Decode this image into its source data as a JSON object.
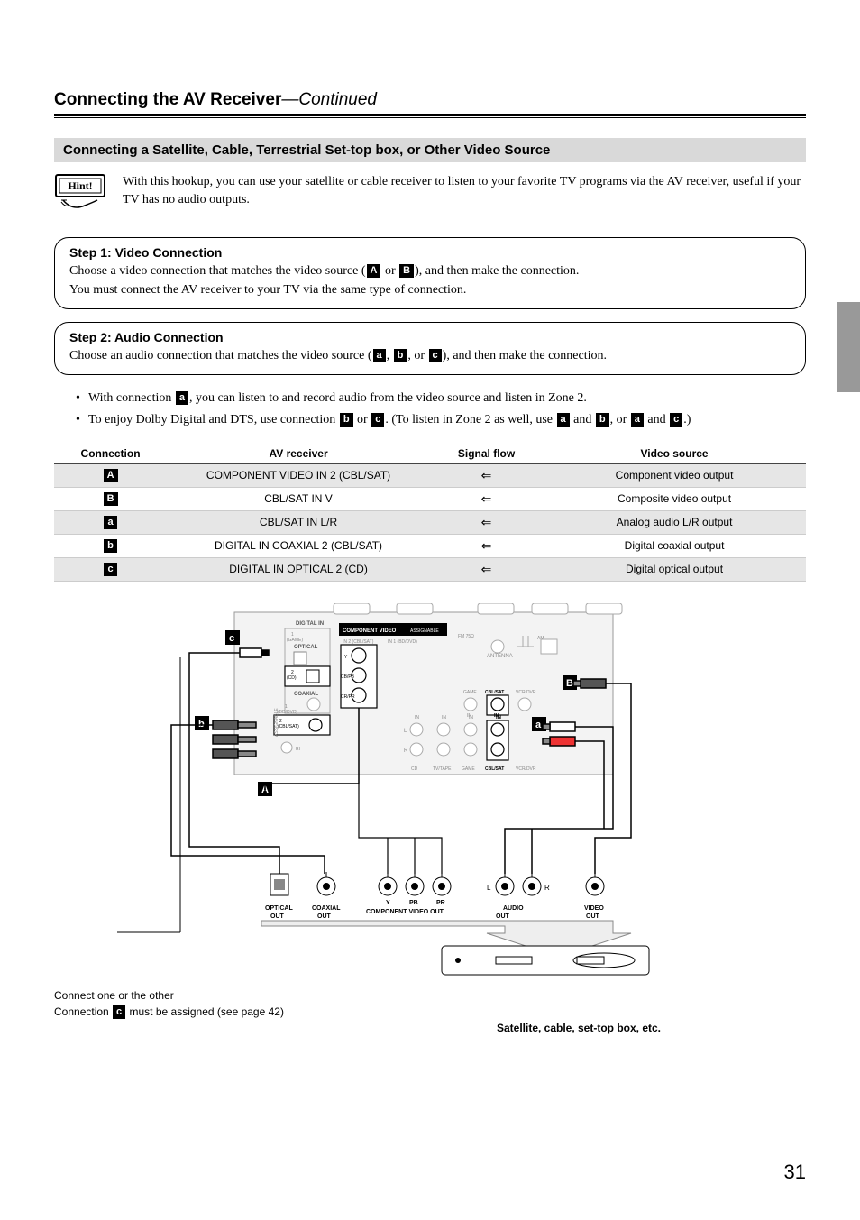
{
  "page": {
    "title_main": "Connecting the AV Receiver",
    "title_continued": "—Continued",
    "number": "31"
  },
  "section_bar": "Connecting a Satellite, Cable, Terrestrial Set-top box, or Other Video Source",
  "hint": {
    "label": "Hint!",
    "text": "With this hookup, you can use your satellite or cable receiver to listen to your favorite TV programs via the AV receiver, useful if your TV has no audio outputs."
  },
  "step1": {
    "title": "Step 1: Video Connection",
    "line1_a": "Choose a video connection that matches the video source (",
    "chip1": "A",
    "line1_b": " or ",
    "chip2": "B",
    "line1_c": "), and then make the connection.",
    "line2": "You must connect the AV receiver to your TV via the same type of connection."
  },
  "step2": {
    "title": "Step 2: Audio Connection",
    "line1_a": "Choose an audio connection that matches the video source (",
    "chip1": "a",
    "sep1": ", ",
    "chip2": "b",
    "sep2": ", or ",
    "chip3": "c",
    "line1_b": "), and then make the connection."
  },
  "bullets": {
    "b1_a": "With connection ",
    "b1_chip": "a",
    "b1_b": ", you can listen to and record audio from the video source and listen in Zone 2.",
    "b2_a": "To enjoy Dolby Digital and DTS, use connection ",
    "b2_chip1": "b",
    "b2_b": " or ",
    "b2_chip2": "c",
    "b2_c": ". (To listen in Zone 2 as well, use ",
    "b2_chip3": "a",
    "b2_d": " and ",
    "b2_chip4": "b",
    "b2_e": ", or ",
    "b2_chip5": "a",
    "b2_f": " and ",
    "b2_chip6": "c",
    "b2_g": ".)"
  },
  "table": {
    "headers": [
      "Connection",
      "AV receiver",
      "Signal flow",
      "Video source"
    ],
    "rows": [
      {
        "chip": "A",
        "recv": "COMPONENT VIDEO IN 2 (CBL/SAT)",
        "flow": "⇐",
        "src": "Component video output",
        "shade": true
      },
      {
        "chip": "B",
        "recv": "CBL/SAT IN V",
        "flow": "⇐",
        "src": "Composite video output",
        "shade": false
      },
      {
        "chip": "a",
        "recv": "CBL/SAT IN L/R",
        "flow": "⇐",
        "src": "Analog audio L/R output",
        "shade": true
      },
      {
        "chip": "b",
        "recv": "DIGITAL IN COAXIAL 2 (CBL/SAT)",
        "flow": "⇐",
        "src": "Digital coaxial output",
        "shade": false
      },
      {
        "chip": "c",
        "recv": "DIGITAL IN OPTICAL 2 (CD)",
        "flow": "⇐",
        "src": "Digital optical output",
        "shade": true
      }
    ]
  },
  "diagram": {
    "chip_c": "c",
    "chip_b": "b",
    "chip_A": "A",
    "chip_B": "B",
    "chip_a": "a",
    "labels": {
      "digital_in": "DIGITAL IN",
      "optical": "OPTICAL",
      "coaxial": "COAXIAL",
      "component_video": "COMPONENT VIDEO",
      "antenna": "ANTENNA",
      "fm": "FM 75Ω",
      "am": "AM",
      "game": "GAME",
      "cblsat": "CBL/SAT",
      "vcrdvr": "VCR/DVR",
      "cd": "CD",
      "tvtape": "TV/TAPE",
      "in": "IN",
      "l": "L",
      "r": "R",
      "y": "Y",
      "pb": "PB",
      "pr": "PR",
      "cbpb": "CB/PB",
      "crpr": "CR/PR",
      "in2": "IN 2 (CBL/SAT)",
      "in1": "IN 1 (BD/DVD)",
      "assignable": "ASSIGNABLE",
      "one": "1",
      "two": "2",
      "game_full": "(GAME)",
      "cblsat_full": "(CBL/SAT)",
      "cd_full": "(CD)"
    },
    "bottom": {
      "optical_out": "OPTICAL\nOUT",
      "coaxial_out": "COAXIAL\nOUT",
      "y": "Y",
      "pb": "PB",
      "pr": "PR",
      "comp_out": "COMPONENT VIDEO OUT",
      "audio_out": "AUDIO\nOUT",
      "video_out": "VIDEO\nOUT",
      "l": "L",
      "r": "R"
    }
  },
  "footer": {
    "note1": "Connect one or the other",
    "note2_a": "Connection ",
    "note2_chip": "c",
    "note2_b": " must be assigned (see page 42)",
    "sat_caption": "Satellite, cable, set-top box, etc."
  }
}
